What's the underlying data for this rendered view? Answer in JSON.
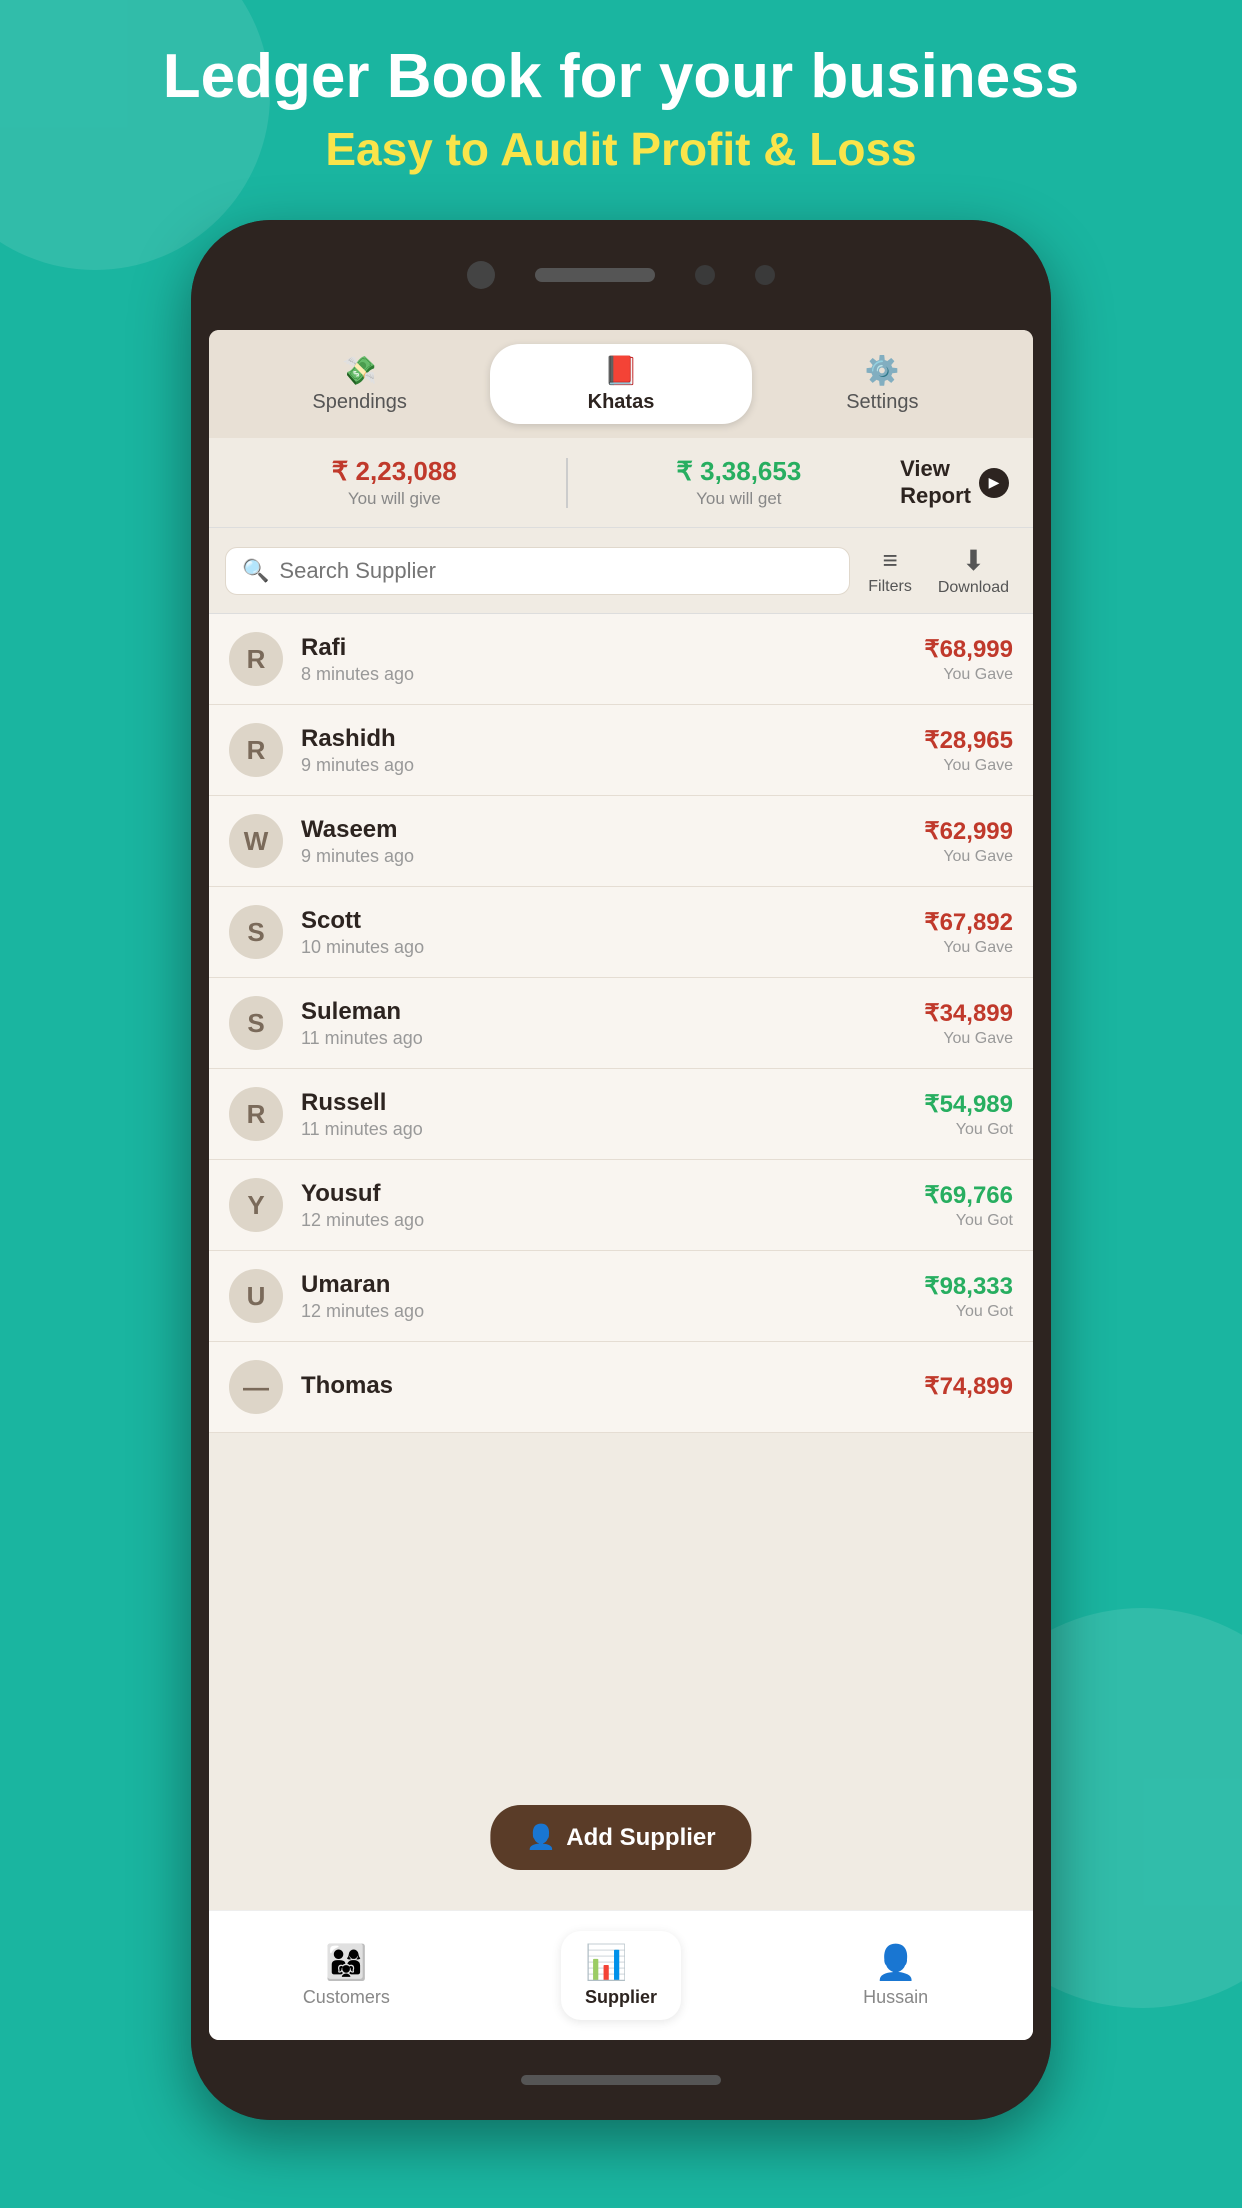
{
  "header": {
    "title": "Ledger Book for your business",
    "subtitle": "Easy to Audit Profit & Loss"
  },
  "nav_tabs": [
    {
      "id": "spendings",
      "label": "Spendings",
      "icon": "💸",
      "active": false
    },
    {
      "id": "khatas",
      "label": "Khatas",
      "icon": "📕",
      "active": true
    },
    {
      "id": "settings",
      "label": "Settings",
      "icon": "⚙️",
      "active": false
    }
  ],
  "summary": {
    "give_amount": "₹ 2,23,088",
    "give_label": "You will give",
    "get_amount": "₹ 3,38,653",
    "get_label": "You will get",
    "report_label": "View\nReport"
  },
  "search": {
    "placeholder": "Search Supplier"
  },
  "filters": {
    "label": "Filters",
    "download_label": "Download"
  },
  "suppliers": [
    {
      "initial": "R",
      "name": "Rafi",
      "time": "8 minutes ago",
      "amount": "₹68,999",
      "status": "You Gave",
      "type": "gave"
    },
    {
      "initial": "R",
      "name": "Rashidh",
      "time": "9 minutes ago",
      "amount": "₹28,965",
      "status": "You Gave",
      "type": "gave"
    },
    {
      "initial": "W",
      "name": "Waseem",
      "time": "9 minutes ago",
      "amount": "₹62,999",
      "status": "You Gave",
      "type": "gave"
    },
    {
      "initial": "S",
      "name": "Scott",
      "time": "10 minutes ago",
      "amount": "₹67,892",
      "status": "You Gave",
      "type": "gave"
    },
    {
      "initial": "S",
      "name": "Suleman",
      "time": "11 minutes ago",
      "amount": "₹34,899",
      "status": "You Gave",
      "type": "gave"
    },
    {
      "initial": "R",
      "name": "Russell",
      "time": "11 minutes ago",
      "amount": "₹54,989",
      "status": "You Got",
      "type": "got"
    },
    {
      "initial": "Y",
      "name": "Yousuf",
      "time": "12 minutes ago",
      "amount": "₹69,766",
      "status": "You Got",
      "type": "got"
    },
    {
      "initial": "U",
      "name": "Umaran",
      "time": "12 minutes ago",
      "amount": "₹98,333",
      "status": "You Got",
      "type": "got"
    },
    {
      "initial": "—",
      "name": "Thomas",
      "time": "",
      "amount": "₹74,899",
      "status": "",
      "type": "gave"
    }
  ],
  "add_supplier_btn": "Add Supplier",
  "bottom_nav": [
    {
      "id": "customers",
      "label": "Customers",
      "icon": "👨‍👩‍👧",
      "active": false
    },
    {
      "id": "supplier",
      "label": "Supplier",
      "icon": "📊",
      "active": true
    },
    {
      "id": "hussain",
      "label": "Hussain",
      "icon": "👤",
      "active": false
    }
  ]
}
